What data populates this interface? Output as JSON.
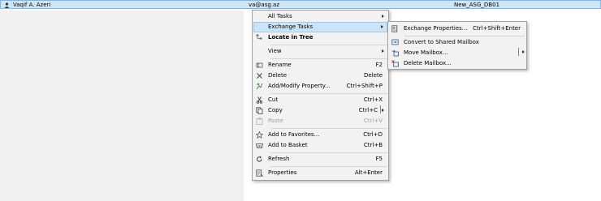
{
  "row": {
    "name": "Vaqif A. Azeri",
    "email": "va@asg.az",
    "database": "New_ASG_DB01"
  },
  "context_menu": {
    "items": [
      {
        "label": "All Tasks",
        "icon": "",
        "shortcut": "",
        "submenu": true
      },
      {
        "label": "Exchange Tasks",
        "icon": "",
        "shortcut": "",
        "submenu": true,
        "highlighted": true
      },
      {
        "label": "Locate in Tree",
        "icon": "locate-icon",
        "shortcut": "",
        "bold": true
      },
      {
        "label": "View",
        "icon": "",
        "shortcut": "",
        "submenu": true
      },
      {
        "label": "Rename",
        "icon": "rename-icon",
        "shortcut": "F2"
      },
      {
        "label": "Delete",
        "icon": "delete-icon",
        "shortcut": "Delete"
      },
      {
        "label": "Add/Modify Property...",
        "icon": "add-property-icon",
        "shortcut": "Ctrl+Shift+P"
      },
      {
        "label": "Cut",
        "icon": "cut-icon",
        "shortcut": "Ctrl+X"
      },
      {
        "label": "Copy",
        "icon": "copy-icon",
        "shortcut": "Ctrl+C",
        "submenu": true
      },
      {
        "label": "Paste",
        "icon": "paste-icon",
        "shortcut": "Ctrl+V",
        "disabled": true
      },
      {
        "label": "Add to Favorites...",
        "icon": "star-icon",
        "shortcut": "Ctrl+D"
      },
      {
        "label": "Add to Basket",
        "icon": "basket-icon",
        "shortcut": "Ctrl+B"
      },
      {
        "label": "Refresh",
        "icon": "refresh-icon",
        "shortcut": "F5"
      },
      {
        "label": "Properties",
        "icon": "properties-icon",
        "shortcut": "Alt+Enter"
      }
    ]
  },
  "submenu": {
    "items": [
      {
        "label": "Exchange Properties...",
        "shortcut": "Ctrl+Shift+Enter",
        "icon": "exchange-properties-icon"
      },
      {
        "label": "Convert to Shared Mailbox",
        "shortcut": "",
        "icon": "convert-icon"
      },
      {
        "label": "Move Mailbox...",
        "shortcut": "",
        "icon": "move-mailbox-icon",
        "submenu": true
      },
      {
        "label": "Delete Mailbox...",
        "shortcut": "",
        "icon": "delete-mailbox-icon"
      }
    ]
  }
}
